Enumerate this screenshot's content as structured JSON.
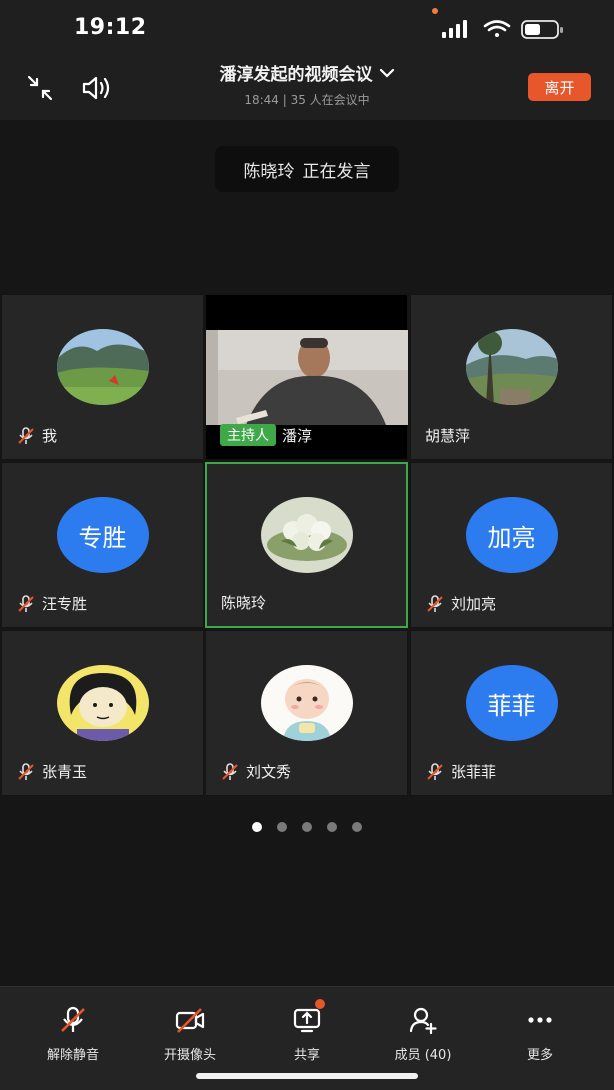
{
  "status": {
    "time": "19:12"
  },
  "header": {
    "title": "潘淳发起的视频会议",
    "subtitle": "18:44 | 35 人在会议中",
    "leave_label": "离开"
  },
  "speaking": {
    "name": "陈晓玲",
    "text": "正在发言"
  },
  "tiles": [
    {
      "name": "我",
      "muted": true,
      "avatar": "photo-mountain"
    },
    {
      "name": "潘淳",
      "host_label": "主持人",
      "muted": false,
      "video": true
    },
    {
      "name": "胡慧萍",
      "muted": false,
      "avatar": "photo-valley"
    },
    {
      "name": "汪专胜",
      "muted": true,
      "avatar_text": "专胜"
    },
    {
      "name": "陈晓玲",
      "muted": false,
      "active_speaker": true,
      "avatar": "photo-flowers"
    },
    {
      "name": "刘加亮",
      "muted": true,
      "avatar_text": "加亮"
    },
    {
      "name": "张青玉",
      "muted": true,
      "avatar": "cartoon-girl"
    },
    {
      "name": "刘文秀",
      "muted": true,
      "avatar": "cartoon-baby"
    },
    {
      "name": "张菲菲",
      "muted": true,
      "avatar_text": "菲菲"
    }
  ],
  "pager": {
    "pages": 5,
    "current": 1
  },
  "toolbar": {
    "unmute": "解除静音",
    "camera": "开摄像头",
    "share": "共享",
    "members": "成员 (40)",
    "more": "更多"
  },
  "colors": {
    "accent_green": "#3fa94a",
    "leave_red": "#e8562b",
    "avatar_blue": "#2c7cf0"
  }
}
